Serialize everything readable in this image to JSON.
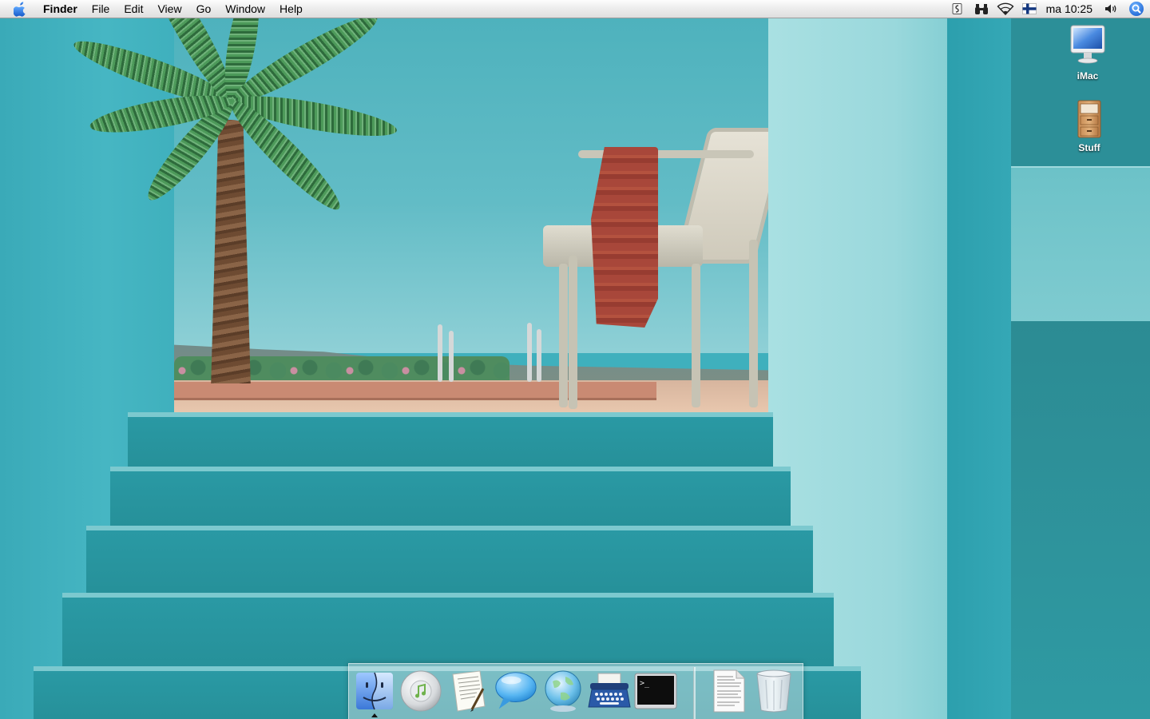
{
  "menubar": {
    "app_name": "Finder",
    "items": [
      "File",
      "Edit",
      "View",
      "Go",
      "Window",
      "Help"
    ],
    "clock": "ma 10:25",
    "status_icons": [
      "script-icon",
      "binoculars-icon",
      "wifi-icon",
      "flag-finland-icon",
      "volume-icon",
      "spotlight-icon"
    ]
  },
  "desktop": {
    "icons": [
      {
        "label": "iMac",
        "icon": "imac-icon"
      },
      {
        "label": "Stuff",
        "icon": "filing-cabinet-icon"
      }
    ]
  },
  "dock": {
    "apps": [
      {
        "icon": "finder-icon",
        "running": true
      },
      {
        "icon": "itunes-icon",
        "running": false
      },
      {
        "icon": "textedit-icon",
        "running": false
      },
      {
        "icon": "ichat-icon",
        "running": false
      },
      {
        "icon": "network-globe-icon",
        "running": false
      },
      {
        "icon": "typewriter-icon",
        "running": false
      },
      {
        "icon": "terminal-icon",
        "running": false
      }
    ],
    "docs": [
      {
        "icon": "document-icon"
      },
      {
        "icon": "trash-icon"
      }
    ]
  },
  "colors": {
    "accent": "#1a6fe0",
    "wallpaper_teal": "#3fb0bd"
  }
}
